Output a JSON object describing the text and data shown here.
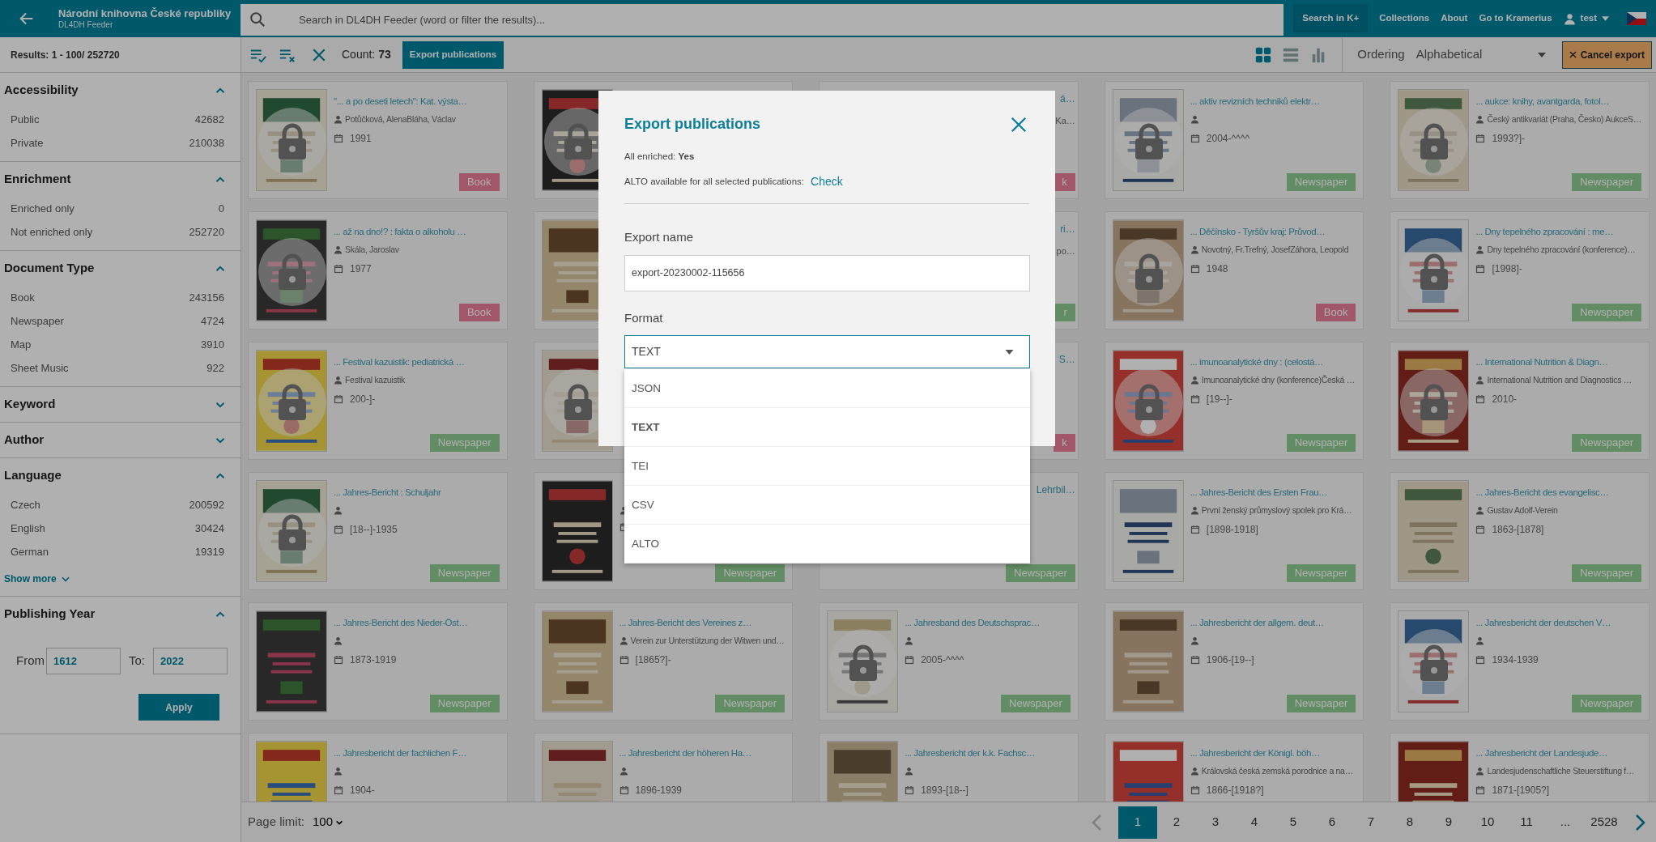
{
  "header": {
    "library_name": "Národní knihovna České republiky",
    "app_name": "DL4DH Feeder",
    "search": {
      "placeholder": "Search in DL4DH Feeder (word or filter the results)..."
    },
    "nav": [
      {
        "label": "Search in K+",
        "kind": "boxed"
      },
      {
        "label": "Collections",
        "kind": "plain"
      },
      {
        "label": "About",
        "kind": "plain"
      },
      {
        "label": "Go to Kramerius",
        "kind": "plain"
      }
    ],
    "user": "test"
  },
  "results_summary": "Results: 1 - 100/ 252720",
  "filters": [
    {
      "kind": "list",
      "title": "Accessibility",
      "expanded": true,
      "items": [
        {
          "label": "Public",
          "count": "42682"
        },
        {
          "label": "Private",
          "count": "210038"
        }
      ]
    },
    {
      "kind": "list",
      "title": "Enrichment",
      "expanded": true,
      "items": [
        {
          "label": "Enriched only",
          "count": "0"
        },
        {
          "label": "Not enriched only",
          "count": "252720"
        }
      ]
    },
    {
      "kind": "list",
      "title": "Document Type",
      "expanded": true,
      "items": [
        {
          "label": "Book",
          "count": "243156"
        },
        {
          "label": "Newspaper",
          "count": "4724"
        },
        {
          "label": "Map",
          "count": "3910"
        },
        {
          "label": "Sheet Music",
          "count": "922"
        }
      ]
    },
    {
      "kind": "list",
      "title": "Keyword",
      "expanded": false
    },
    {
      "kind": "list",
      "title": "Author",
      "expanded": false
    },
    {
      "kind": "list",
      "title": "Language",
      "expanded": true,
      "items": [
        {
          "label": "Czech",
          "count": "200592"
        },
        {
          "label": "English",
          "count": "30424"
        },
        {
          "label": "German",
          "count": "19319"
        }
      ],
      "show_more": "Show more"
    },
    {
      "kind": "year_range",
      "title": "Publishing Year",
      "expanded": true,
      "from_label": "From",
      "from": "1612",
      "to_label": "To:",
      "to": "2022",
      "apply": "Apply"
    }
  ],
  "toolbar": {
    "count_label": "Count:",
    "count": "73",
    "export_button": "Export publications",
    "views": [
      {
        "kind": "grid",
        "selected": true
      },
      {
        "kind": "list",
        "selected": false
      },
      {
        "kind": "chart",
        "selected": false
      }
    ],
    "ordering_label": "Ordering",
    "ordering_value": "Alphabetical",
    "cancel_button": "Cancel export"
  },
  "cards": [
    {
      "kind": "full",
      "title": "\"... a po deseti letech\": Kat. výsta…",
      "author": "Potůčková, AlenaBláha, Václav",
      "date": "1991",
      "badge": {
        "label": "Book",
        "kind": "book"
      },
      "locked": true
    },
    {
      "kind": "covered_left",
      "locked": true
    },
    {
      "kind": "covered_right",
      "title": "á…",
      "author": "Ka…",
      "badge": {
        "label": "k",
        "kind": "book"
      }
    },
    {
      "kind": "full",
      "title": "... aktiv revizních techniků elektr…",
      "date": "2004-^^^^",
      "badge": {
        "label": "Newspaper",
        "kind": "newspaper"
      },
      "locked": true
    },
    {
      "kind": "full",
      "title": "... aukce: knihy, avantgarda, fotol…",
      "author": "Český antikvariát (Praha, Česko) AukceS…",
      "date": "1993?]-",
      "badge": {
        "label": "Newspaper",
        "kind": "newspaper"
      },
      "locked": true
    },
    {
      "kind": "full",
      "title": "... až na dno!? : fakta o alkoholu …",
      "author": "Skála, Jaroslav",
      "date": "1977",
      "badge": {
        "label": "Book",
        "kind": "book"
      },
      "locked": true
    },
    {
      "kind": "covered_left",
      "locked": false
    },
    {
      "kind": "covered_right",
      "title": "ri…",
      "author": "po…",
      "badge": {
        "label": "r",
        "kind": "newspaper"
      }
    },
    {
      "kind": "full",
      "title": "... Děčínsko - Tyršův kraj: Průvod…",
      "author": "Novotný, Fr.Trefný, JosefZáhora, Leopold",
      "date": "1948",
      "badge": {
        "label": "Book",
        "kind": "book"
      },
      "locked": true
    },
    {
      "kind": "full",
      "title": "... Dny tepelného zpracování : me…",
      "author": "Dny tepelného zpracování (konference)…",
      "date": "[1998]-",
      "badge": {
        "label": "Newspaper",
        "kind": "newspaper"
      },
      "locked": true
    },
    {
      "kind": "full",
      "title": "... Festival kazuistik: pediatrická …",
      "author": "Festival kazuistik",
      "date": "200-]-",
      "badge": {
        "label": "Newspaper",
        "kind": "newspaper"
      },
      "locked": true
    },
    {
      "kind": "covered_left",
      "locked": true
    },
    {
      "kind": "covered_right",
      "title": "S…",
      "badge": {
        "label": "k",
        "kind": "book"
      }
    },
    {
      "kind": "full",
      "title": "... imunoanalytické dny : (celostá…",
      "author": "Imunoanalytické dny (konference)Česká …",
      "date": "[19--]-",
      "badge": {
        "label": "Newspaper",
        "kind": "newspaper"
      },
      "locked": true
    },
    {
      "kind": "full",
      "title": "... International Nutrition & Diagn…",
      "author": "International Nutrition and Diagnostics …",
      "date": "2010-",
      "badge": {
        "label": "Newspaper",
        "kind": "newspaper"
      },
      "locked": true
    },
    {
      "kind": "full",
      "title": "... Jahres-Bericht : Schuljahr",
      "date": "[18--]-1935",
      "badge": {
        "label": "Newspaper",
        "kind": "newspaper"
      },
      "locked": true
    },
    {
      "kind": "full",
      "badge": {
        "label": "Newspaper",
        "kind": "newspaper"
      },
      "locked": false
    },
    {
      "kind": "covered_right",
      "title": "Lehrbil…",
      "badge": {
        "label": "Newspaper",
        "kind": "newspaper"
      }
    },
    {
      "kind": "full",
      "title": "... Jahres-Bericht des Ersten Frau…",
      "author": "První ženský průmyslový spolek pro Krá…",
      "date": "[1898-1918]",
      "badge": {
        "label": "Newspaper",
        "kind": "newspaper"
      },
      "locked": false
    },
    {
      "kind": "full",
      "title": "... Jahres-Bericht des evangelisc…",
      "author": "Gustav Adolf-Verein",
      "date": "1863-[1878]",
      "badge": {
        "label": "Newspaper",
        "kind": "newspaper"
      },
      "locked": false
    },
    {
      "kind": "full",
      "title": "... Jahres-Bericht des Nieder-Öst…",
      "date": "1873-1919",
      "badge": {
        "label": "Newspaper",
        "kind": "newspaper"
      },
      "locked": false
    },
    {
      "kind": "full",
      "title": "... Jahres-Bericht des Vereines z…",
      "author": "Verein zur Unterstützung der Witwen und…",
      "date": "[1865?]-",
      "badge": {
        "label": "Newspaper",
        "kind": "newspaper"
      },
      "locked": false
    },
    {
      "kind": "full",
      "title": "... Jahresband des Deutschsprac…",
      "date": "2005-^^^^",
      "badge": {
        "label": "Newspaper",
        "kind": "newspaper"
      },
      "locked": true
    },
    {
      "kind": "full",
      "title": "... Jahresbericht der allgem. deut…",
      "date": "1906-[19--]",
      "badge": {
        "label": "Newspaper",
        "kind": "newspaper"
      },
      "locked": false
    },
    {
      "kind": "full",
      "title": "... Jahresbericht der deutschen V…",
      "date": "1934-1939",
      "badge": {
        "label": "Newspaper",
        "kind": "newspaper"
      },
      "locked": true
    },
    {
      "kind": "full",
      "title": "... Jahresbericht der fachlichen F…",
      "date": "1904-",
      "locked": false
    },
    {
      "kind": "full",
      "title": "... Jahresbericht der höheren Ha…",
      "date": "1896-1939",
      "locked": false
    },
    {
      "kind": "full",
      "title": "... Jahresbericht der k.k. Fachsc…",
      "date": "1893-[18--]",
      "locked": false
    },
    {
      "kind": "full",
      "title": "... Jahresbericht der Königl. böh…",
      "author": "Královská česká zemská porodnice a na…",
      "date": "1866-[1918?]",
      "locked": false
    },
    {
      "kind": "full",
      "title": "... Jahresbericht der Landesjude…",
      "author": "Landesjudenschaftliche Steuerstiftung f…",
      "date": "1871-[1905?]",
      "locked": false
    }
  ],
  "pagination": {
    "page_limit_label": "Page limit:",
    "page_limit": "100",
    "previous": {
      "disabled": true
    },
    "next": {
      "disabled": false
    },
    "pages": [
      {
        "label": "1",
        "selected": true
      },
      {
        "label": "2",
        "selected": false
      },
      {
        "label": "3",
        "selected": false
      },
      {
        "label": "4",
        "selected": false
      },
      {
        "label": "5",
        "selected": false
      },
      {
        "label": "6",
        "selected": false
      },
      {
        "label": "7",
        "selected": false
      },
      {
        "label": "8",
        "selected": false
      },
      {
        "label": "9",
        "selected": false
      },
      {
        "label": "10",
        "selected": false
      },
      {
        "label": "11",
        "selected": false
      },
      {
        "label": "...",
        "selected": false
      },
      {
        "label": "2528",
        "selected": false
      }
    ]
  },
  "dialog": {
    "title": "Export publications",
    "enriched": "All enriched: **Yes**",
    "alto_label": "ALTO available for all selected publications:",
    "alto_link": "Check",
    "name_label": "Export name",
    "name_value": "export-20230002-115656",
    "format_label": "Format",
    "format_value": "TEXT",
    "options": [
      {
        "label": "JSON",
        "selected": false
      },
      {
        "label": "TEXT",
        "selected": true
      },
      {
        "label": "TEI",
        "selected": false
      },
      {
        "label": "CSV",
        "selected": false
      },
      {
        "label": "ALTO",
        "selected": false
      }
    ]
  }
}
